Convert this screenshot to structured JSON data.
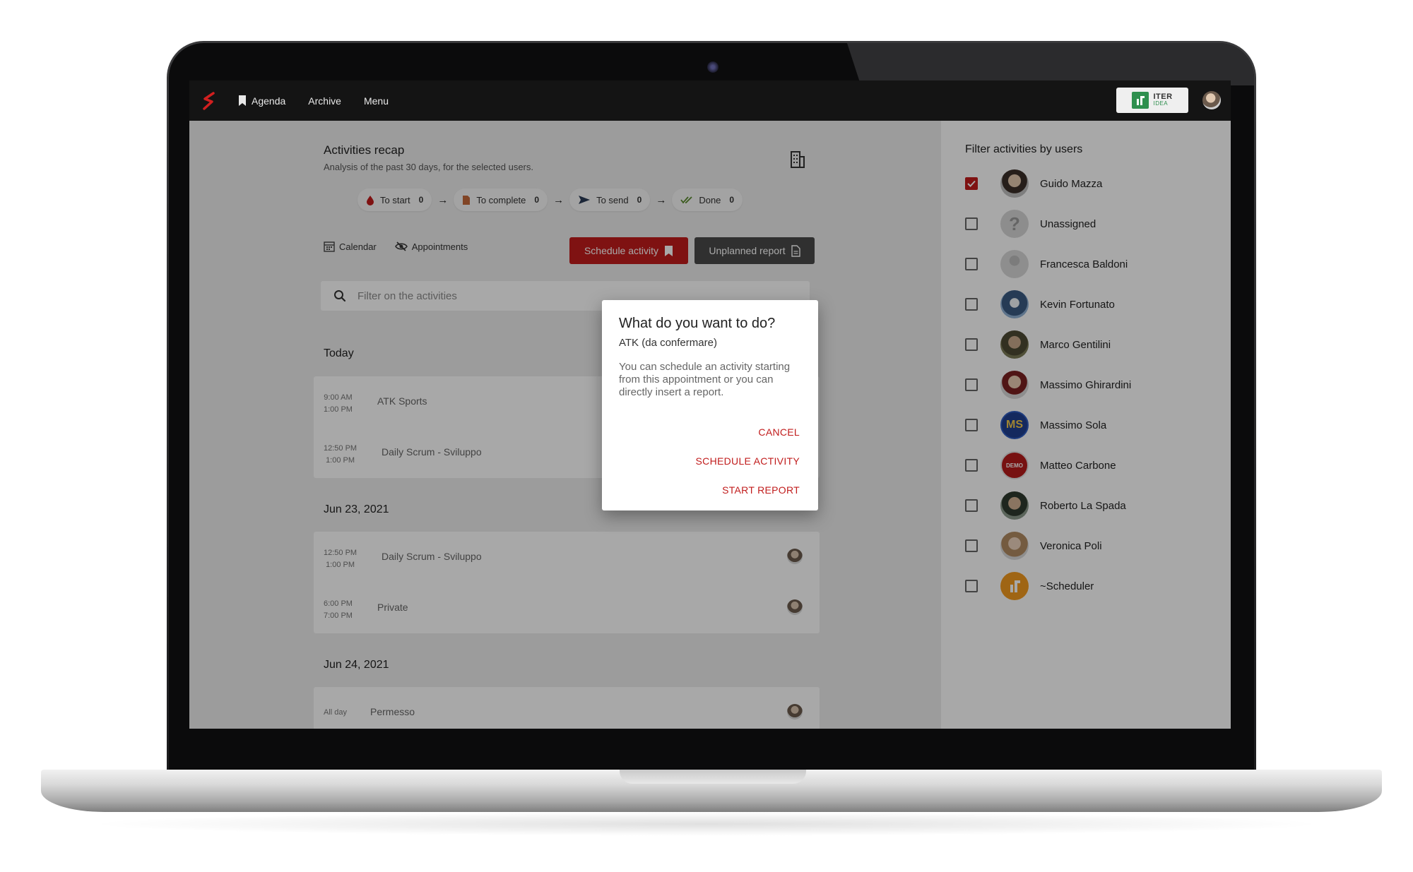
{
  "nav": {
    "agenda": "Agenda",
    "archive": "Archive",
    "menu": "Menu",
    "brand_line1": "ITER",
    "brand_line2": "IDEA"
  },
  "recap": {
    "title": "Activities recap",
    "subtitle": "Analysis of the past 30 days, for the selected users.",
    "pipeline": [
      {
        "label": "To start",
        "count": "0",
        "icon": "drop-icon"
      },
      {
        "label": "To complete",
        "count": "0",
        "icon": "document-icon"
      },
      {
        "label": "To send",
        "count": "0",
        "icon": "send-icon"
      },
      {
        "label": "Done",
        "count": "0",
        "icon": "double-check-icon"
      }
    ]
  },
  "views": {
    "calendar": "Calendar",
    "appointments": "Appointments"
  },
  "actions": {
    "schedule": "Schedule activity",
    "unplanned": "Unplanned report"
  },
  "search": {
    "placeholder": "Filter on the activities"
  },
  "days": [
    {
      "title": "Today",
      "items": [
        {
          "start": "9:00 AM",
          "end": "1:00 PM",
          "title": "ATK Sports"
        },
        {
          "start": "12:50 PM",
          "end": "1:00 PM",
          "title": "Daily Scrum - Sviluppo"
        }
      ]
    },
    {
      "title": "Jun 23, 2021",
      "items": [
        {
          "start": "12:50 PM",
          "end": "1:00 PM",
          "title": "Daily Scrum - Sviluppo"
        },
        {
          "start": "6:00 PM",
          "end": "7:00 PM",
          "title": "Private"
        }
      ]
    },
    {
      "title": "Jun 24, 2021",
      "items": [
        {
          "start": "All day",
          "end": "",
          "title": "Permesso"
        }
      ]
    }
  ],
  "filter": {
    "title": "Filter activities by users",
    "users": [
      {
        "name": "Guido Mazza",
        "checked": true
      },
      {
        "name": "Unassigned",
        "checked": false
      },
      {
        "name": "Francesca Baldoni",
        "checked": false
      },
      {
        "name": "Kevin Fortunato",
        "checked": false
      },
      {
        "name": "Marco Gentilini",
        "checked": false
      },
      {
        "name": "Massimo Ghirardini",
        "checked": false
      },
      {
        "name": "Massimo Sola",
        "checked": false,
        "initials": "MS"
      },
      {
        "name": "Matteo Carbone",
        "checked": false,
        "badge": "DEMO"
      },
      {
        "name": "Roberto La Spada",
        "checked": false
      },
      {
        "name": "Veronica Poli",
        "checked": false
      },
      {
        "name": "~Scheduler",
        "checked": false
      }
    ]
  },
  "dialog": {
    "title": "What do you want to do?",
    "subtitle": "ATK (da confermare)",
    "body": "You can schedule an activity starting from this appointment or you can directly insert a report.",
    "cancel": "CANCEL",
    "schedule": "SCHEDULE ACTIVITY",
    "report": "START REPORT"
  },
  "colors": {
    "accent": "#c11c1c",
    "topbar": "#141414",
    "brand_green": "#2e8f4e"
  }
}
